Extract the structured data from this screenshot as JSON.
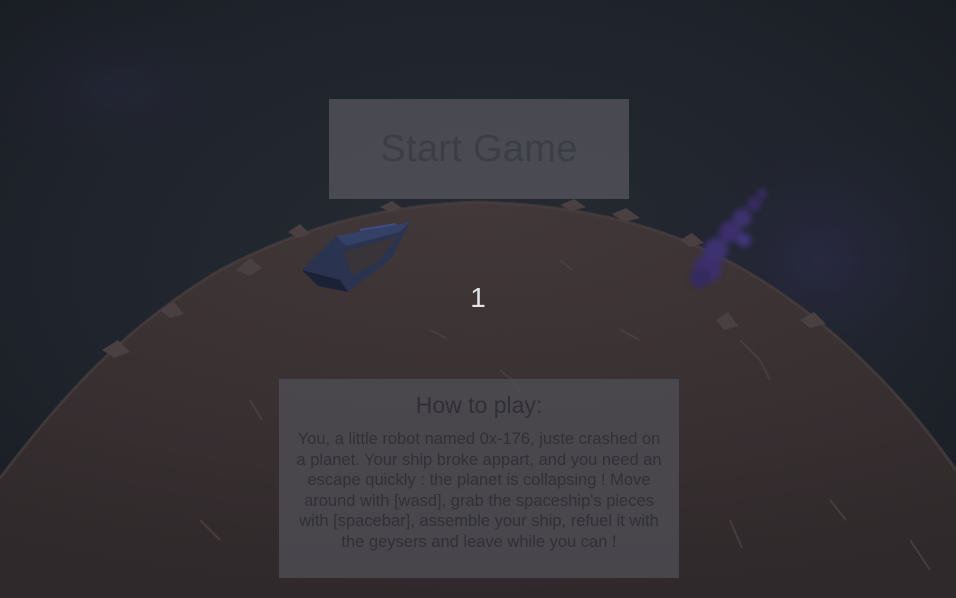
{
  "menu": {
    "start_button_label": "Start Game"
  },
  "hud": {
    "counter": "1"
  },
  "instructions": {
    "title": "How to play:",
    "body": "You, a little robot named 0x-176, juste crashed on a planet. Your ship broke appart, and you need an escape quickly : the planet is collapsing ! Move around with [wasd], grab the spaceship's pieces with [spacebar], assemble your ship, refuel it with the geysers and leave while you can !"
  },
  "colors": {
    "sky": "#1d2128",
    "planet_surface": "#3a302f",
    "ship": "#2a3552",
    "purple_geyser": "#3a2f6a"
  }
}
